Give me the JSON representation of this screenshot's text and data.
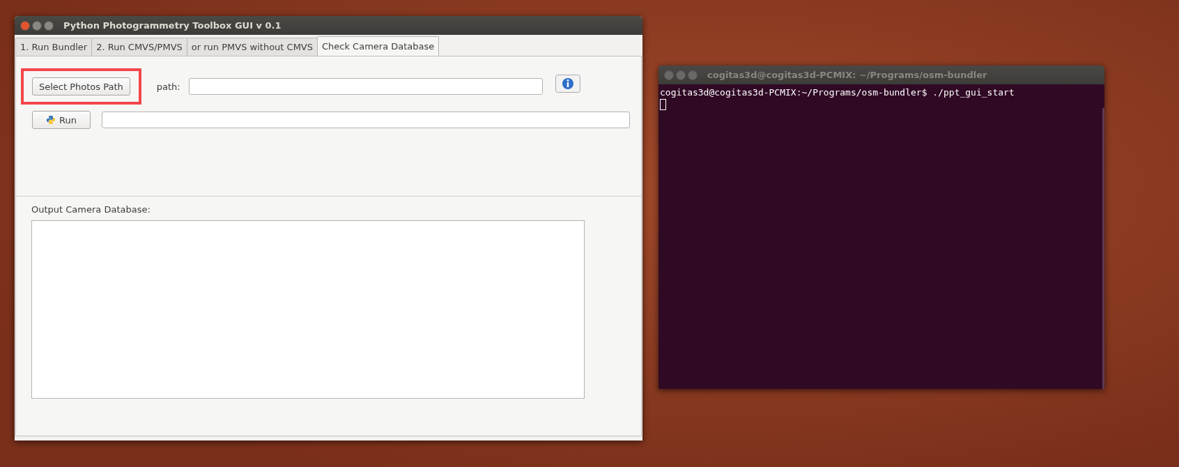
{
  "gui_window": {
    "title": "Python Photogrammetry Toolbox GUI v 0.1",
    "tabs": [
      {
        "label": "1. Run Bundler",
        "selected": false
      },
      {
        "label": "2. Run CMVS/PMVS",
        "selected": false
      },
      {
        "label": "or run PMVS without CMVS",
        "selected": false
      },
      {
        "label": "Check Camera Database",
        "selected": true
      }
    ],
    "select_button": {
      "label": "Select Photos Path",
      "highlighted": true
    },
    "path_label": "path:",
    "run_button": {
      "label": "Run"
    },
    "output_label": "Output Camera Database:"
  },
  "terminal": {
    "title": "cogitas3d@cogitas3d-PCMIX: ~/Programs/osm-bundler",
    "lines": [
      "cogitas3d@cogitas3d-PCMIX:~/Programs/osm-bundler$ ./ppt_gui_start"
    ]
  }
}
